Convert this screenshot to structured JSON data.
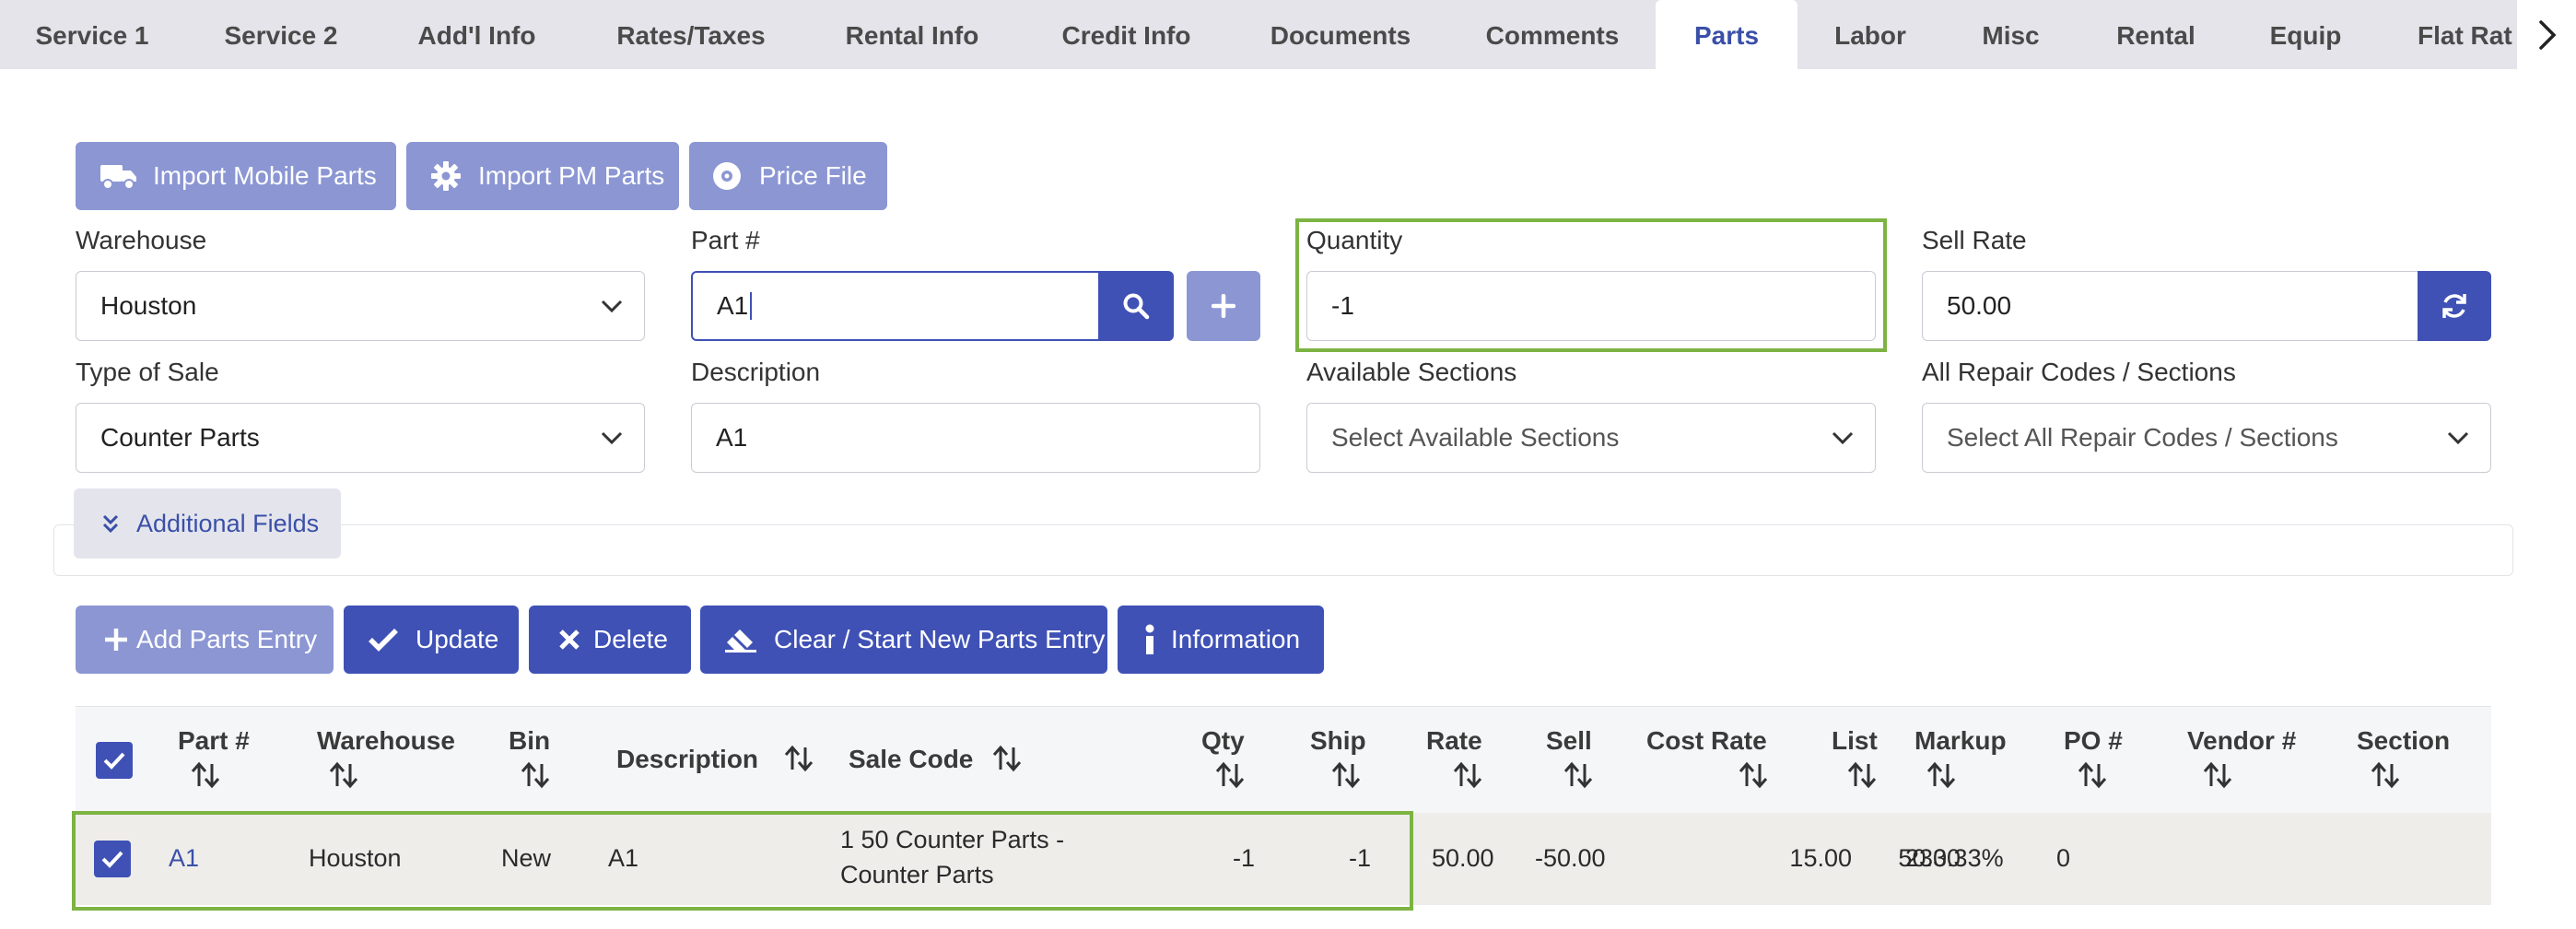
{
  "tabs": [
    {
      "label": "Service 1"
    },
    {
      "label": "Service 2"
    },
    {
      "label": "Add'l Info"
    },
    {
      "label": "Rates/Taxes"
    },
    {
      "label": "Rental Info"
    },
    {
      "label": "Credit Info"
    },
    {
      "label": "Documents"
    },
    {
      "label": "Comments"
    },
    {
      "label": "Parts"
    },
    {
      "label": "Labor"
    },
    {
      "label": "Misc"
    },
    {
      "label": "Rental"
    },
    {
      "label": "Equip"
    },
    {
      "label": "Flat Rat"
    }
  ],
  "active_tab": "Parts",
  "import": {
    "mobile_label": "Import Mobile Parts",
    "pm_label": "Import PM Parts",
    "price_file_label": "Price File"
  },
  "form": {
    "warehouse": {
      "label": "Warehouse",
      "value": "Houston"
    },
    "part_number": {
      "label": "Part #",
      "value": "A1"
    },
    "quantity": {
      "label": "Quantity",
      "value": "-1"
    },
    "sell_rate": {
      "label": "Sell Rate",
      "value": "50.00"
    },
    "type_of_sale": {
      "label": "Type of Sale",
      "value": "Counter Parts"
    },
    "description": {
      "label": "Description",
      "value": "A1"
    },
    "available_sections": {
      "label": "Available Sections",
      "placeholder": "Select Available Sections"
    },
    "repair_codes": {
      "label": "All Repair Codes / Sections",
      "placeholder": "Select All Repair Codes / Sections"
    },
    "additional_fields_label": "Additional Fields"
  },
  "actions": {
    "add_label": "Add Parts Entry",
    "update_label": "Update",
    "delete_label": "Delete",
    "clear_label": "Clear / Start New Parts Entry",
    "info_label": "Information"
  },
  "table": {
    "columns": {
      "part": "Part #",
      "warehouse": "Warehouse",
      "bin": "Bin",
      "description": "Description",
      "sale_code": "Sale Code",
      "qty": "Qty",
      "ship": "Ship",
      "rate": "Rate",
      "sell": "Sell",
      "cost_rate": "Cost Rate",
      "list": "List",
      "markup": "Markup",
      "po": "PO #",
      "vendor": "Vendor #",
      "section": "Section"
    },
    "rows": [
      {
        "part": "A1",
        "warehouse": "Houston",
        "bin": "New",
        "description": "A1",
        "sale_code_line1": "1 50 Counter Parts -",
        "sale_code_line2": "Counter Parts",
        "qty": "-1",
        "ship": "-1",
        "rate": "50.00",
        "sell": "-50.00",
        "cost_rate": "15.00",
        "list": "50.00",
        "markup": "233.33%",
        "po": "0",
        "vendor": "",
        "section": ""
      }
    ]
  },
  "colors": {
    "accent": "#3f51b5",
    "accent_light": "#8b96d3",
    "highlight": "#7cb342",
    "tab_bar": "#e4e4ea"
  }
}
